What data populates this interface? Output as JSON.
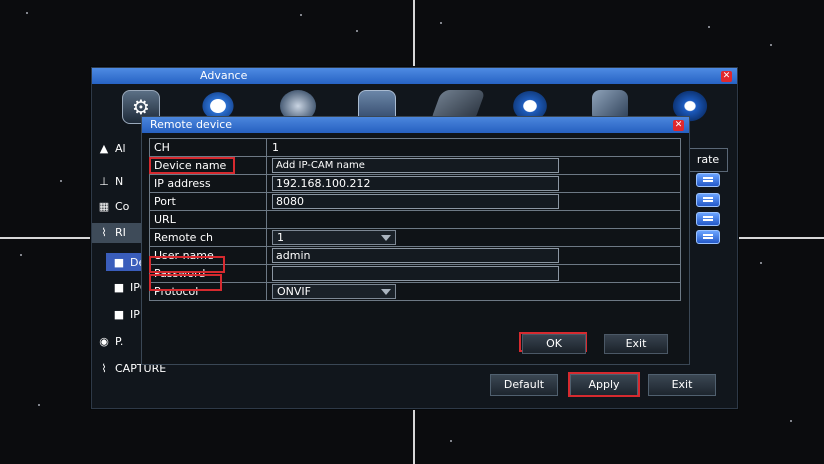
{
  "advance_window": {
    "title": "Advance",
    "toolbar_icons": [
      "settings-icon",
      "gear-icon",
      "globe-icon",
      "calendar-icon",
      "disk-icon",
      "info-icon",
      "tools-icon",
      "power-icon"
    ],
    "side_menu": {
      "items": [
        {
          "label": "Al",
          "icon": "alarm-icon"
        },
        {
          "label": "N",
          "icon": "network-icon"
        },
        {
          "label": "Co",
          "icon": "grid-icon"
        },
        {
          "label": "RI",
          "icon": "remote-icon"
        }
      ],
      "sub_items": [
        {
          "label": "De"
        },
        {
          "label": "IPC"
        },
        {
          "label": "IP"
        }
      ],
      "p_item": "P.",
      "capture": "CAPTURE"
    },
    "rate_header": "rate",
    "buttons": {
      "default": "Default",
      "apply": "Apply",
      "exit": "Exit"
    }
  },
  "remote_device_dialog": {
    "title": "Remote device",
    "rows": {
      "ch": {
        "label": "CH",
        "value": "1"
      },
      "device_name": {
        "label": "Device name",
        "value": "Add IP-CAM name"
      },
      "ip_address": {
        "label": "IP address",
        "value": "192.168.100.212"
      },
      "port": {
        "label": "Port",
        "value": "8080"
      },
      "url": {
        "label": "URL",
        "value": ""
      },
      "remote_ch": {
        "label": "Remote ch",
        "value": "1"
      },
      "user_name": {
        "label": "User name",
        "value": "admin"
      },
      "password": {
        "label": "Password",
        "value": ""
      },
      "protocol": {
        "label": "Protocol",
        "value": "ONVIF"
      }
    },
    "buttons": {
      "ok": "OK",
      "exit": "Exit"
    }
  },
  "colors": {
    "highlight": "#d62a2f",
    "title_bar": "#3a78d6",
    "close": "#e0282d"
  }
}
